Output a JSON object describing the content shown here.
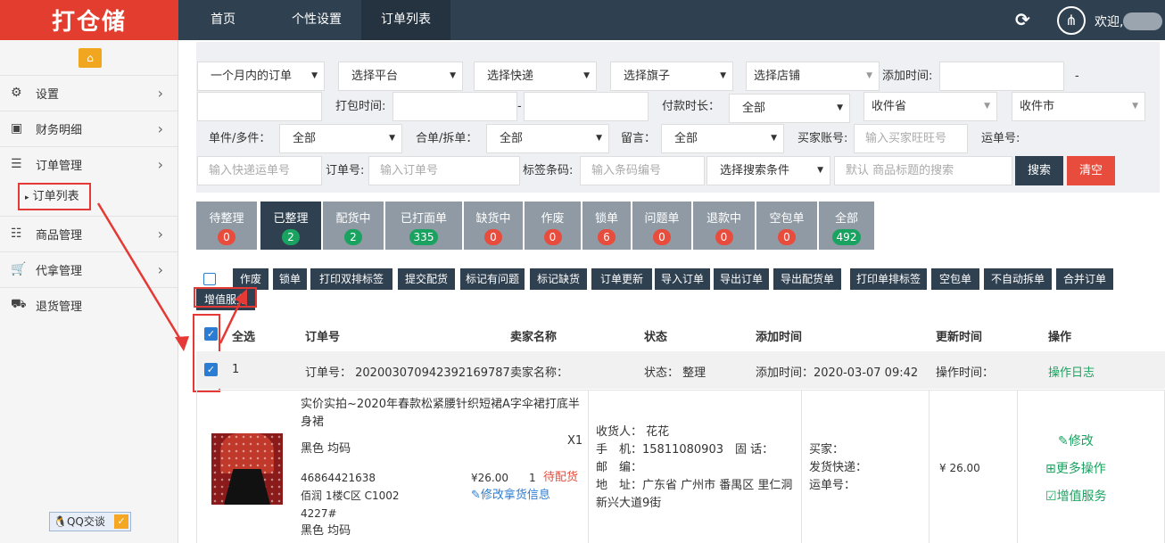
{
  "header": {
    "logo": "打仓储",
    "nav": [
      "首页",
      "个性设置",
      "订单列表"
    ],
    "welcome": "欢迎,"
  },
  "sidebar": {
    "items": [
      "设置",
      "财务明细",
      "订单管理",
      "商品管理",
      "代拿管理",
      "退货管理"
    ],
    "sub_item": "订单列表",
    "qq": "QQ交谈"
  },
  "filters": {
    "period": "一个月内的订单",
    "platform": "选择平台",
    "express": "选择快递",
    "flag": "选择旗子",
    "shop": "选择店铺",
    "add_time_label": "添加时间:",
    "dash": "-",
    "pack_time_label": "打包时间:",
    "pay_duration_label": "付款时长：",
    "pay_duration": "全部",
    "province": "收件省",
    "city": "收件市",
    "single_multi_label": "单件/多件：",
    "single_multi": "全部",
    "merge_split_label": "合单/拆单：",
    "merge_split": "全部",
    "message_label": "留言：",
    "message": "全部",
    "buyer_label": "买家账号:",
    "buyer_placeholder": "输入买家旺旺号",
    "waybill_label": "运单号:",
    "waybill_placeholder": "输入快递运单号",
    "order_no_label": "订单号:",
    "order_no_placeholder": "输入订单号",
    "barcode_label": "标签条码:",
    "barcode_placeholder": "输入条码编号",
    "search_condition": "选择搜索条件",
    "keyword_placeholder": "默认 商品标题的搜索",
    "search_btn": "搜索",
    "clear_btn": "清空"
  },
  "tabs": [
    {
      "label": "待整理",
      "count": "0",
      "color": "red"
    },
    {
      "label": "已整理",
      "count": "2",
      "color": "green"
    },
    {
      "label": "配货中",
      "count": "2",
      "color": "green"
    },
    {
      "label": "已打面单",
      "count": "335",
      "color": "green"
    },
    {
      "label": "缺货中",
      "count": "0",
      "color": "red"
    },
    {
      "label": "作废",
      "count": "0",
      "color": "red"
    },
    {
      "label": "锁单",
      "count": "6",
      "color": "red"
    },
    {
      "label": "问题单",
      "count": "0",
      "color": "red"
    },
    {
      "label": "退款中",
      "count": "0",
      "color": "red"
    },
    {
      "label": "空包单",
      "count": "0",
      "color": "red"
    },
    {
      "label": "全部",
      "count": "492",
      "color": "green"
    }
  ],
  "actions": [
    "作废",
    "锁单",
    "打印双排标签",
    "提交配货",
    "标记有问题",
    "标记缺货",
    "订单更新",
    "导入订单",
    "导出订单",
    "导出配货单",
    "打印单排标签",
    "空包单",
    "不自动拆单",
    "合并订单",
    "增值服务"
  ],
  "table": {
    "headers": [
      "全选",
      "订单号",
      "卖家名称",
      "状态",
      "添加时间",
      "更新时间",
      "操作"
    ]
  },
  "order": {
    "index": "1",
    "order_no": "订单号： 20200307094239216​9787",
    "seller": "卖家名称：",
    "status": "状态： 整理",
    "add_time": "添加时间：2020-03-07 09:42",
    "update_time": "操作时间：",
    "log": "操作日志",
    "product_title": "实价实拍~2020年春款松紧腰针织短裙A字伞裙打底半身裙",
    "spec": "黑色 均码",
    "qty_mark": "X1",
    "sku": "46864421638",
    "location": "佰润 1楼C区 C1002",
    "location2": "4227#",
    "spec2": "黑色 均码",
    "price": "¥26.00",
    "qty": "1",
    "pick_status": "待配货",
    "edit_pick": "修改拿货信息",
    "receiver": "收货人： 花花",
    "phone": "手　机：15811080903　固 话：",
    "postcode": "邮　编：",
    "address": "地　址：广东省 广州市 番禺区 里仁洞新兴大道9街",
    "buyer": "买家：",
    "ship_express": "发货快递：",
    "waybill": "运单号：",
    "amount": "¥ 26.00",
    "op_edit": "修改",
    "op_more": "更多操作",
    "op_value": "增值服务"
  }
}
